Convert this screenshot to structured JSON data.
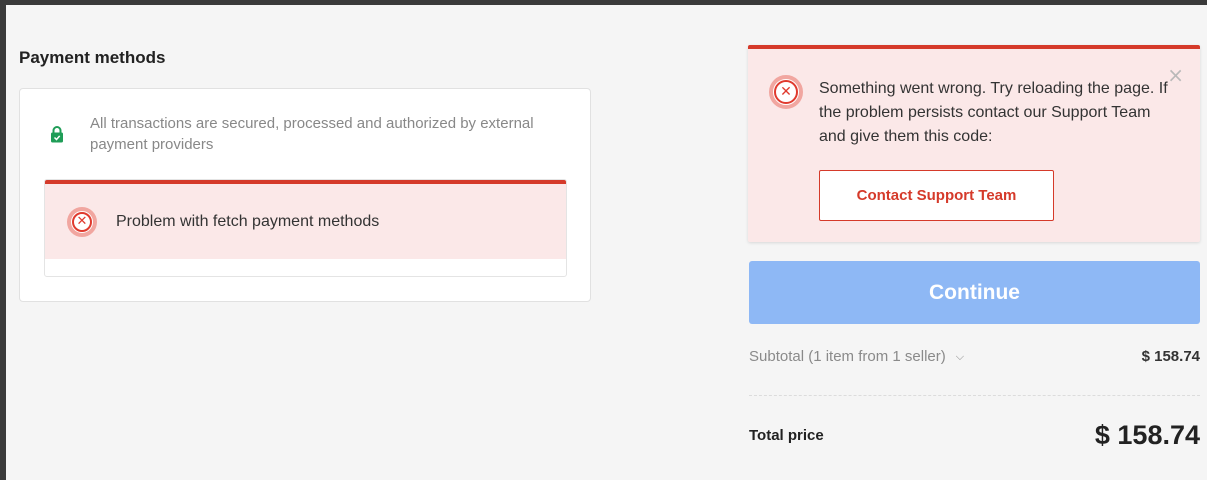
{
  "payment": {
    "title": "Payment methods",
    "secure_text": "All transactions are secured, processed and authorized by external payment providers",
    "error_text": "Problem with fetch payment methods"
  },
  "alert": {
    "message": "Something went wrong. Try reloading the page. If the problem persists contact our Support Team and give them this code:",
    "support_button": "Contact Support Team",
    "close_glyph": "×"
  },
  "summary": {
    "continue_label": "Continue",
    "subtotal_label": "Subtotal (1 item from 1 seller)",
    "subtotal_value": "$ 158.74",
    "total_label": "Total price",
    "total_value": "$ 158.74"
  },
  "colors": {
    "error_red": "#d53a2a",
    "error_bg": "#fbe8e8",
    "secure_green": "#1f9d57",
    "continue_disabled": "#8eb8f5"
  },
  "icons": [
    "lock-icon",
    "error-icon",
    "close-icon",
    "chevron-down-icon"
  ]
}
